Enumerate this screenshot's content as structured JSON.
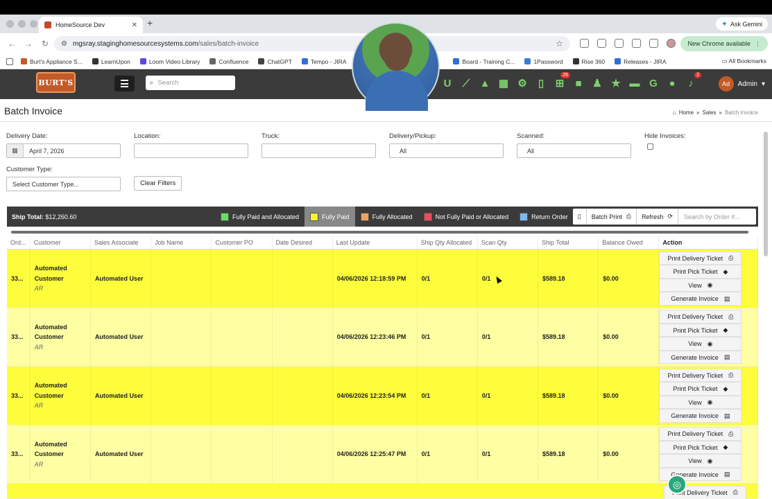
{
  "browser": {
    "tab_title": "HomeSource Dev",
    "new_tab": "+",
    "ask_gemini": "Ask Gemini",
    "url_host": "mgsray.staginghomesourcesystems.com",
    "url_path": "/sales/batch-invoice",
    "new_chrome": "New Chrome available",
    "bookmarks": [
      {
        "label": "Burt's Appliance S...",
        "color": "#c45a28"
      },
      {
        "label": "LearnUpon",
        "color": "#333333"
      },
      {
        "label": "Loom Video Library",
        "color": "#5b4bdb"
      },
      {
        "label": "Confluence",
        "color": "#666666"
      },
      {
        "label": "ChatGPT",
        "color": "#444444"
      },
      {
        "label": "Tempo - JIRA",
        "color": "#2f6fd6"
      },
      {
        "label": "Board - Training C...",
        "color": "#2f6fd6"
      },
      {
        "label": "1Password",
        "color": "#3a7bd5"
      },
      {
        "label": "Rise 360",
        "color": "#333333"
      },
      {
        "label": "Releases - JIRA",
        "color": "#2f6fd6"
      }
    ],
    "all_bookmarks": "All Bookmarks"
  },
  "header": {
    "logo_text": "BURT'S",
    "search_placeholder": "Search",
    "cart_badge": "26",
    "notif_badge": "2",
    "avatar_initials": "Ad",
    "user_label": "Admin"
  },
  "page": {
    "title": "Batch Invoice",
    "breadcrumbs": [
      "Home",
      "Sales",
      "Batch Invoice"
    ]
  },
  "filters": {
    "delivery_date_label": "Delivery Date:",
    "delivery_date_value": "April 7, 2026",
    "location_label": "Location:",
    "truck_label": "Truck:",
    "delivery_pickup_label": "Delivery/Pickup:",
    "delivery_pickup_value": "All",
    "scanned_label": "Scanned:",
    "scanned_value": "All",
    "hide_invoices_label": "Hide Invoices:",
    "customer_type_label": "Customer Type:",
    "customer_type_placeholder": "Select Customer Type...",
    "clear_filters": "Clear Filters"
  },
  "toolbar": {
    "ship_total_label": "Ship Total:",
    "ship_total_value": "$12,260.60",
    "legend": [
      {
        "label": "Fully Paid and Allocated",
        "color": "#5fe35f"
      },
      {
        "label": "Fully Paid",
        "color": "#f5f52a"
      },
      {
        "label": "Fully Allocated",
        "color": "#f0a35e"
      },
      {
        "label": "Not Fully Paid or Allocated",
        "color": "#ef4b5d"
      },
      {
        "label": "Return Order",
        "color": "#7cb8f2"
      }
    ],
    "batch_print": "Batch Print",
    "refresh": "Refresh",
    "search_placeholder": "Search by Order #..."
  },
  "table": {
    "columns": [
      "Ord...",
      "Customer",
      "Sales Associate",
      "Job Name",
      "Customer PO",
      "Date Desired",
      "Last Update",
      "Ship Qty Allocated",
      "Scan Qty",
      "Ship Total",
      "Balance Owed",
      "Action"
    ],
    "actions": [
      "Print Delivery Ticket",
      "Print Pick Ticket",
      "View",
      "Generate Invoice"
    ],
    "rows": [
      {
        "order": "33...",
        "customer1": "Automated",
        "customer2": "Customer",
        "customer_type": "AR",
        "associate": "Automated User",
        "job": "",
        "po": "",
        "date_desired": "",
        "last_update": "04/06/2026 12:18:59 PM",
        "ship_qty": "0/1",
        "scan_qty": "0/1",
        "ship_total": "$589.18",
        "balance": "$0.00"
      },
      {
        "order": "33...",
        "customer1": "Automated",
        "customer2": "Customer",
        "customer_type": "AR",
        "associate": "Automated User",
        "job": "",
        "po": "",
        "date_desired": "",
        "last_update": "04/06/2026 12:23:46 PM",
        "ship_qty": "0/1",
        "scan_qty": "0/1",
        "ship_total": "$589.18",
        "balance": "$0.00"
      },
      {
        "order": "33...",
        "customer1": "Automated",
        "customer2": "Customer",
        "customer_type": "AR",
        "associate": "Automated User",
        "job": "",
        "po": "",
        "date_desired": "",
        "last_update": "04/06/2026 12:23:54 PM",
        "ship_qty": "0/1",
        "scan_qty": "0/1",
        "ship_total": "$589.18",
        "balance": "$0.00"
      },
      {
        "order": "33...",
        "customer1": "Automated",
        "customer2": "Customer",
        "customer_type": "AR",
        "associate": "Automated User",
        "job": "",
        "po": "",
        "date_desired": "",
        "last_update": "04/06/2026 12:25:47 PM",
        "ship_qty": "0/1",
        "scan_qty": "0/1",
        "ship_total": "$589.18",
        "balance": "$0.00"
      }
    ],
    "partial_row_action": "Print Delivery Ticket"
  }
}
